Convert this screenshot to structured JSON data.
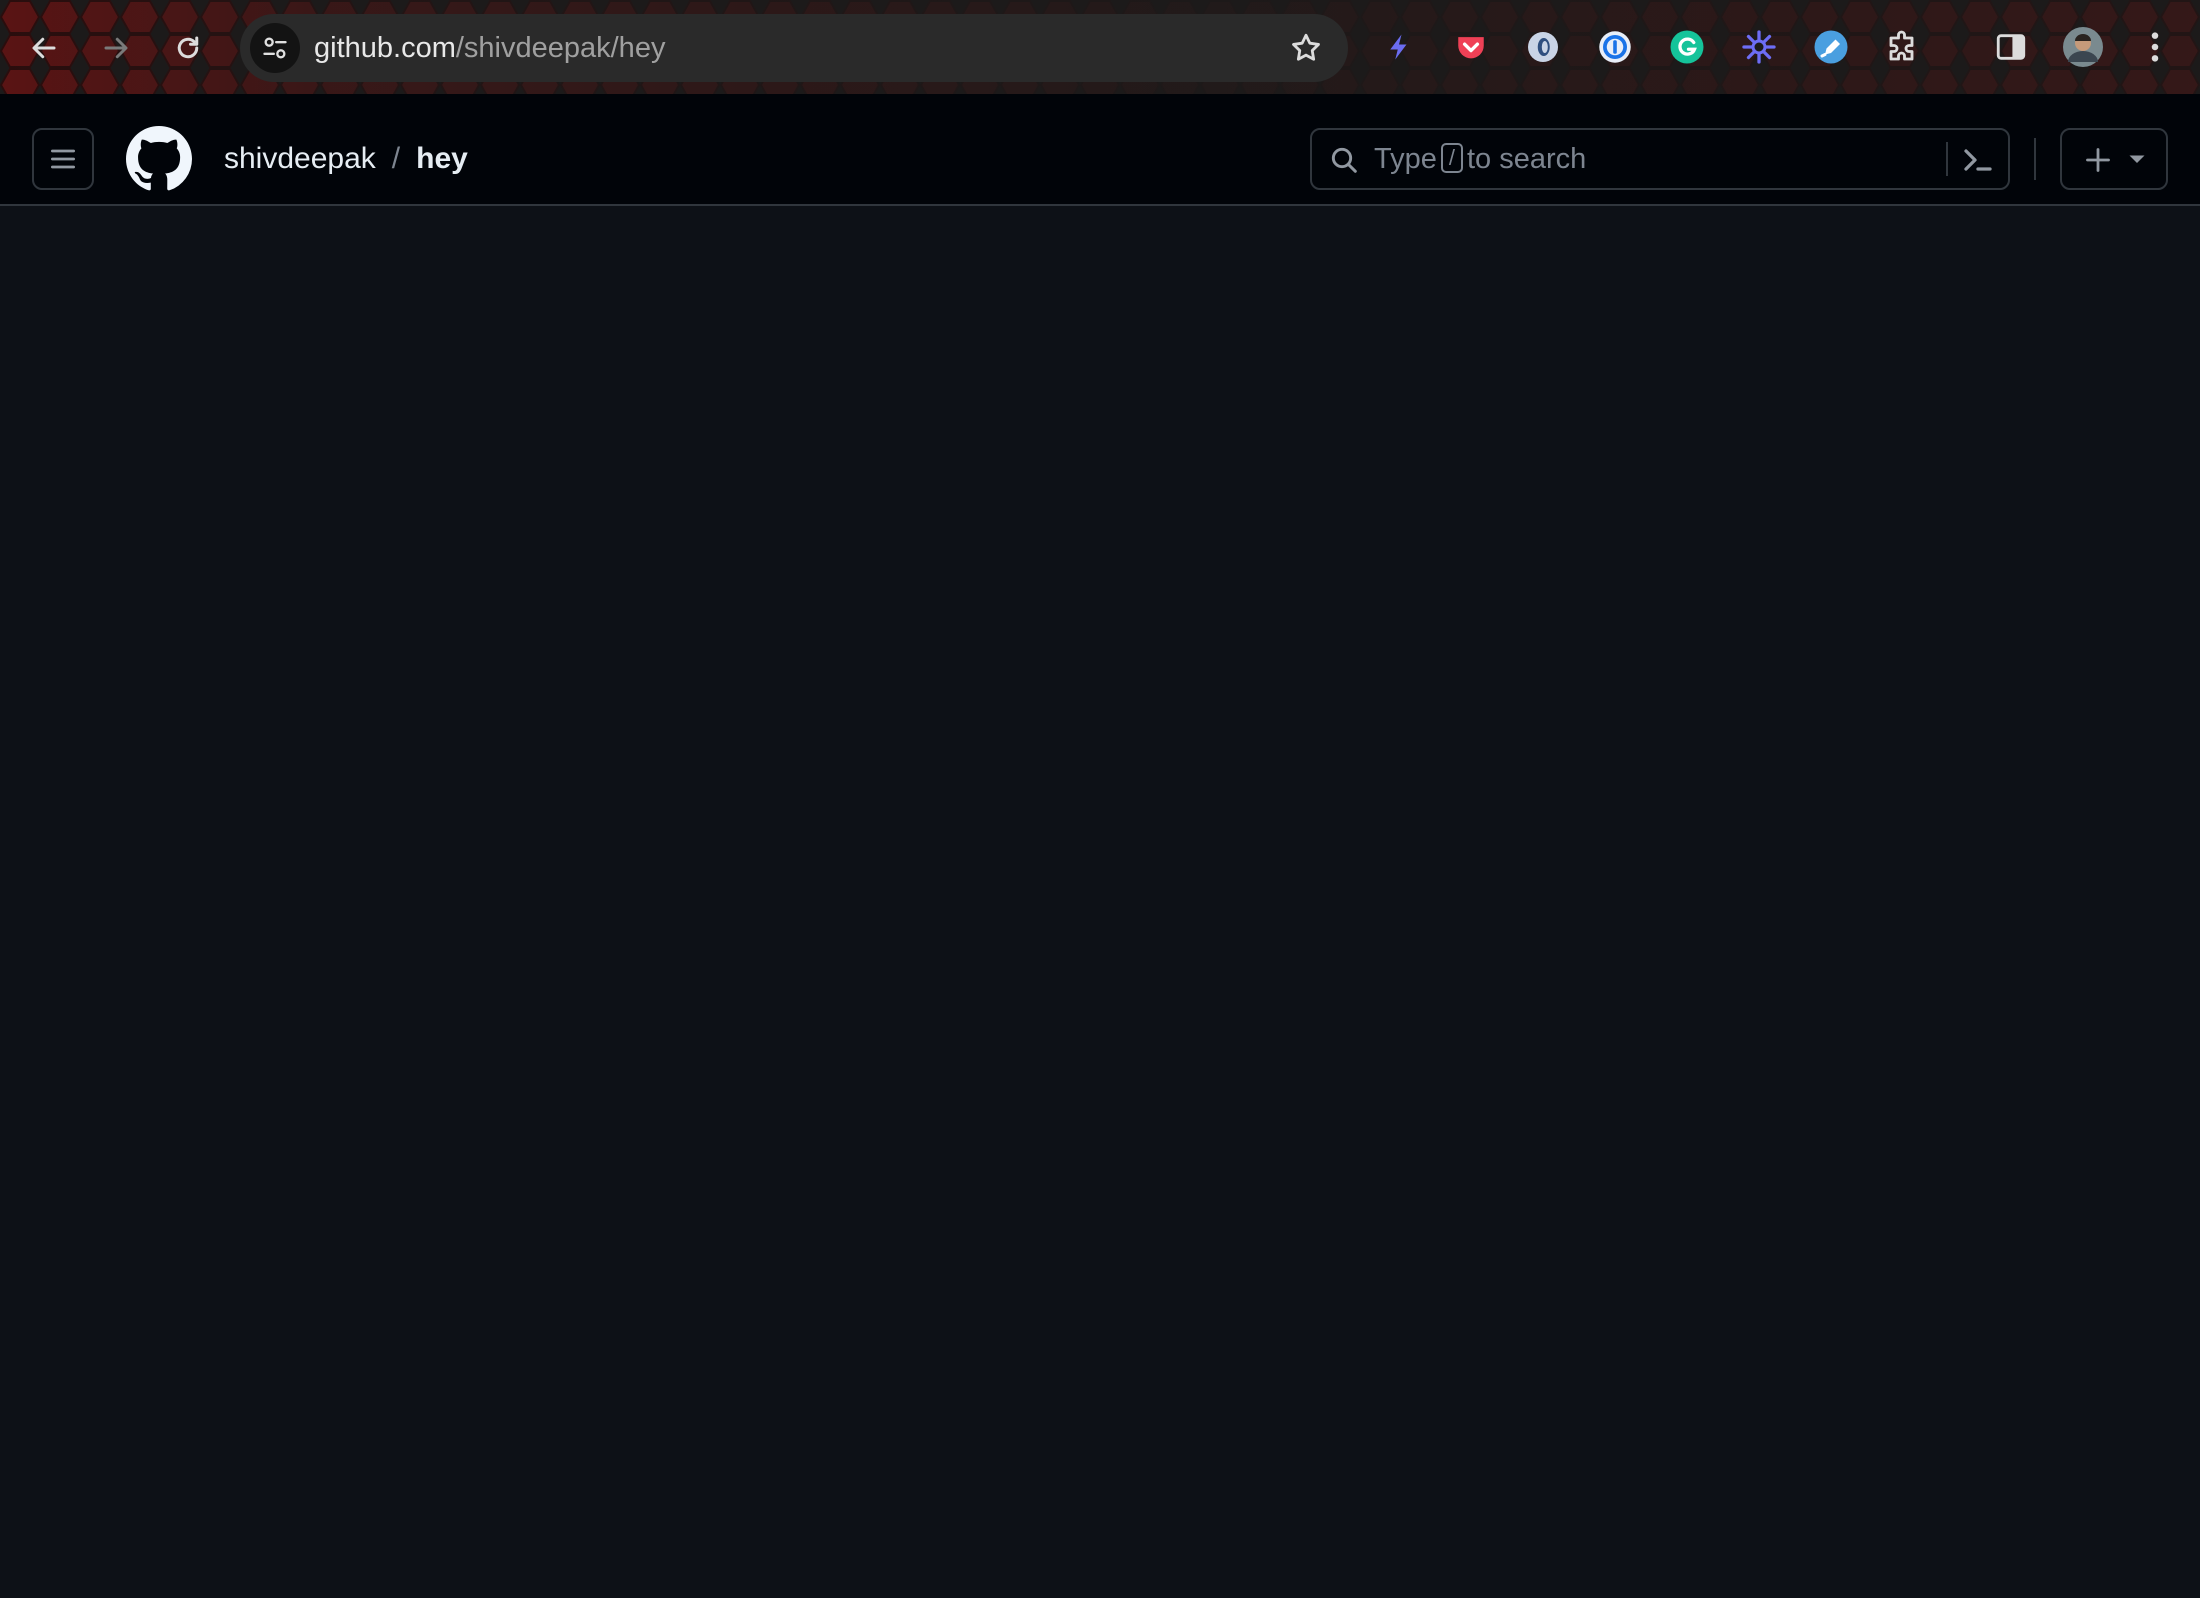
{
  "browser": {
    "url_host": "github.com",
    "url_path": "/shivdeepak/hey",
    "nav": [
      "back-icon",
      "forward-icon",
      "reload-icon"
    ],
    "extensions": [
      "bolt-icon",
      "pocket-icon",
      "circle-ring-icon",
      "password-manager-icon",
      "grammarly-icon",
      "sparkle-icon",
      "pen-icon",
      "puzzle-icon",
      "side-panel-icon",
      "profile-avatar",
      "kebab-menu-icon"
    ],
    "accent": "#8a1f1f"
  },
  "header": {
    "owner": "shivdeepak",
    "separator": "/",
    "repo": "hey",
    "search": {
      "prefix": "Type",
      "key": "/",
      "suffix": "to search"
    },
    "bg": "#010409",
    "border": "#30363d"
  },
  "content": {
    "bg": "#0d1117"
  }
}
